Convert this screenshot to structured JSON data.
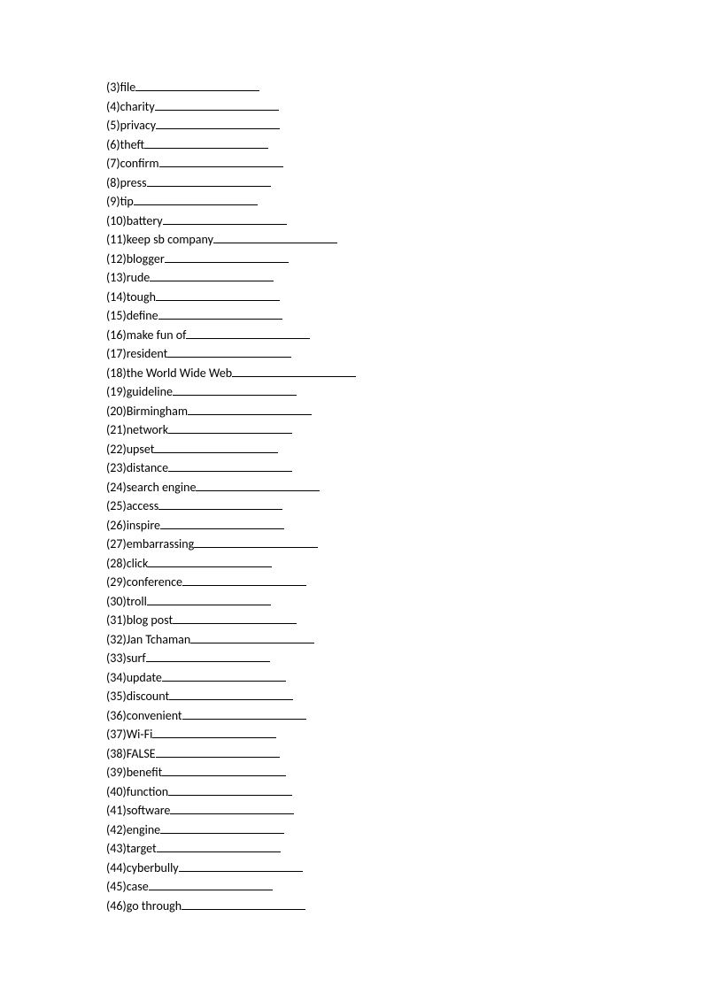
{
  "items": [
    {
      "num": 3,
      "word": "file"
    },
    {
      "num": 4,
      "word": "charity"
    },
    {
      "num": 5,
      "word": "privacy"
    },
    {
      "num": 6,
      "word": "theft"
    },
    {
      "num": 7,
      "word": "confirm"
    },
    {
      "num": 8,
      "word": "press"
    },
    {
      "num": 9,
      "word": "tip"
    },
    {
      "num": 10,
      "word": "battery"
    },
    {
      "num": 11,
      "word": "keep sb company"
    },
    {
      "num": 12,
      "word": "blogger"
    },
    {
      "num": 13,
      "word": "rude"
    },
    {
      "num": 14,
      "word": "tough"
    },
    {
      "num": 15,
      "word": "define"
    },
    {
      "num": 16,
      "word": "make fun of"
    },
    {
      "num": 17,
      "word": "resident"
    },
    {
      "num": 18,
      "word": "the World Wide Web"
    },
    {
      "num": 19,
      "word": "guideline"
    },
    {
      "num": 20,
      "word": "Birmingham"
    },
    {
      "num": 21,
      "word": "network"
    },
    {
      "num": 22,
      "word": "upset"
    },
    {
      "num": 23,
      "word": "distance"
    },
    {
      "num": 24,
      "word": "search engine"
    },
    {
      "num": 25,
      "word": "access"
    },
    {
      "num": 26,
      "word": "inspire"
    },
    {
      "num": 27,
      "word": "embarrassing"
    },
    {
      "num": 28,
      "word": "click"
    },
    {
      "num": 29,
      "word": "conference"
    },
    {
      "num": 30,
      "word": "troll"
    },
    {
      "num": 31,
      "word": "blog post"
    },
    {
      "num": 32,
      "word": "Jan Tchaman"
    },
    {
      "num": 33,
      "word": "surf"
    },
    {
      "num": 34,
      "word": "update"
    },
    {
      "num": 35,
      "word": "discount"
    },
    {
      "num": 36,
      "word": "convenient"
    },
    {
      "num": 37,
      "word": "Wi-Fi"
    },
    {
      "num": 38,
      "word": "FALSE"
    },
    {
      "num": 39,
      "word": "benefit"
    },
    {
      "num": 40,
      "word": "function"
    },
    {
      "num": 41,
      "word": "software"
    },
    {
      "num": 42,
      "word": "engine"
    },
    {
      "num": 43,
      "word": "target"
    },
    {
      "num": 44,
      "word": "cyberbully"
    },
    {
      "num": 45,
      "word": "case"
    },
    {
      "num": 46,
      "word": "go through"
    }
  ]
}
